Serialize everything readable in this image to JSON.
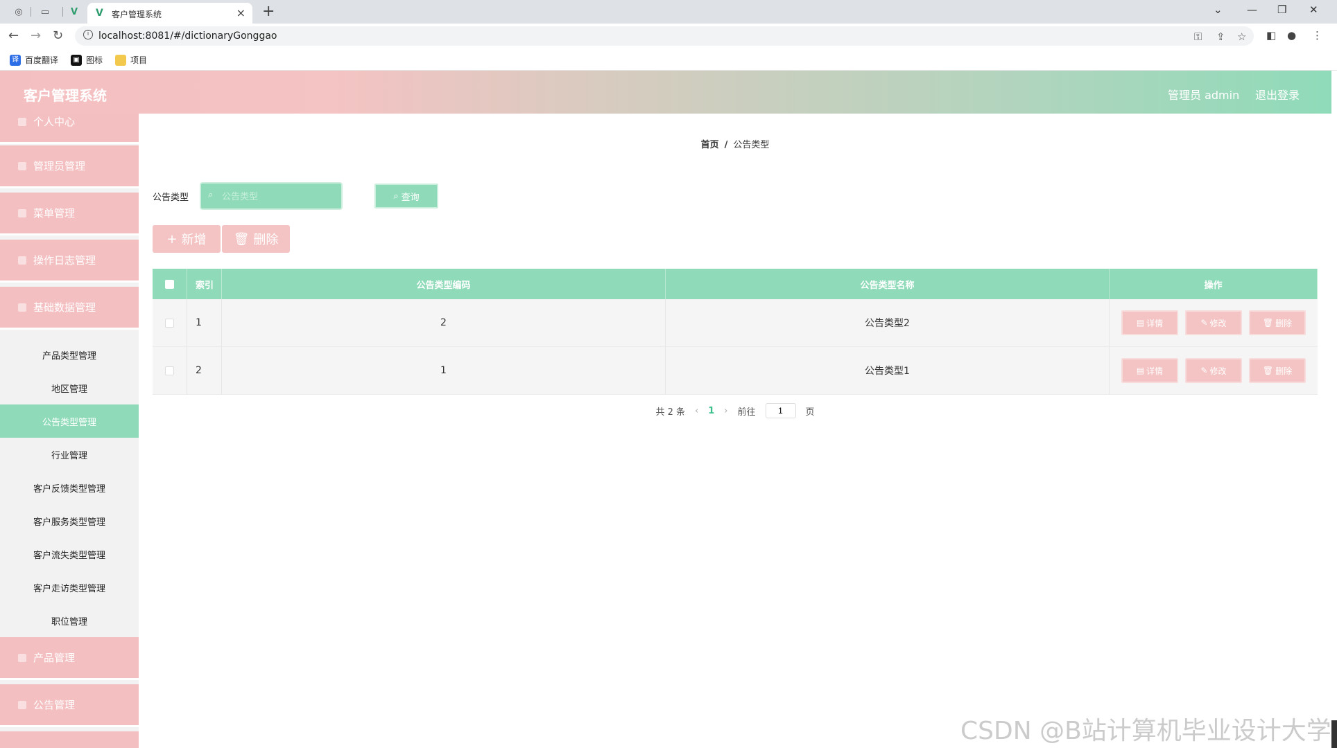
{
  "browser": {
    "tab_title": "客户管理系统",
    "url": "localhost:8081/#/dictionaryGonggao",
    "bookmarks": [
      "百度翻译",
      "图标",
      "项目"
    ]
  },
  "header": {
    "app_title": "客户管理系统",
    "user": "管理员 admin",
    "logout": "退出登录"
  },
  "sidebar": {
    "top_items": [
      "个人中心",
      "管理员管理",
      "菜单管理",
      "操作日志管理",
      "基础数据管理"
    ],
    "sub_items": [
      "产品类型管理",
      "地区管理",
      "公告类型管理",
      "行业管理",
      "客户反馈类型管理",
      "客户服务类型管理",
      "客户流失类型管理",
      "客户走访类型管理",
      "职位管理"
    ],
    "active_sub": "公告类型管理",
    "bottom_items": [
      "产品管理",
      "公告管理"
    ]
  },
  "breadcrumb": {
    "home": "首页",
    "sep": "/",
    "current": "公告类型"
  },
  "search": {
    "label": "公告类型",
    "placeholder": "公告类型",
    "button": "查询"
  },
  "actions": {
    "add": "新增",
    "delete": "删除"
  },
  "table": {
    "headers": {
      "index": "索引",
      "code": "公告类型编码",
      "name": "公告类型名称",
      "ops": "操作"
    },
    "rows": [
      {
        "index": "1",
        "code": "2",
        "name": "公告类型2"
      },
      {
        "index": "2",
        "code": "1",
        "name": "公告类型1"
      }
    ],
    "op_labels": {
      "detail": "详情",
      "edit": "修改",
      "delete": "删除"
    }
  },
  "pagination": {
    "total": "共 2 条",
    "current": "1",
    "goto": "前往",
    "page_value": "1",
    "page_unit": "页"
  },
  "watermark": "CSDN @B站计算机毕业设计大学"
}
